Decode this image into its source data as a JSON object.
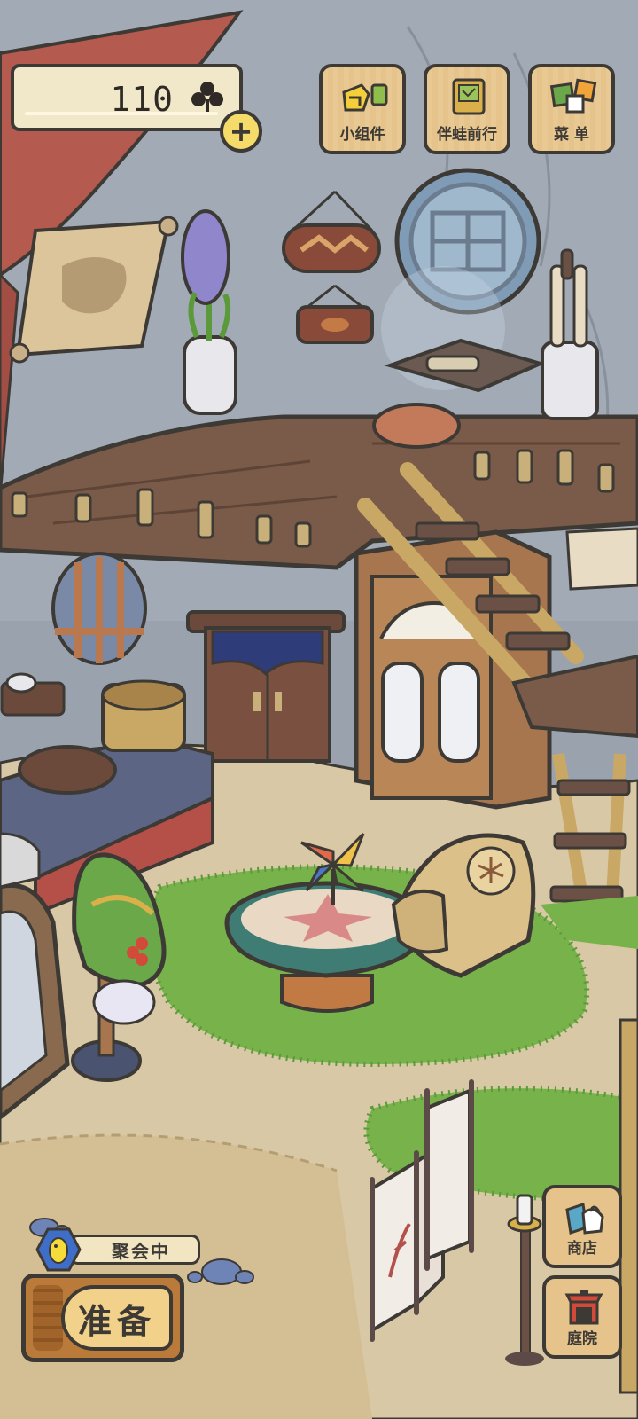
{
  "hud": {
    "clover_count": "110",
    "clover_icon": "clover-icon",
    "add_icon": "plus-icon"
  },
  "top_menu": [
    {
      "label": "小组件",
      "icon": "widget-icon"
    },
    {
      "label": "伴蛙前行",
      "icon": "album-icon"
    },
    {
      "label": "菜 单",
      "icon": "menu-cards-icon"
    }
  ],
  "party": {
    "status_label": "聚会中",
    "icon": "bird-hex-icon"
  },
  "prepare_button": {
    "label": "准备"
  },
  "side_menu": [
    {
      "label": "商店",
      "icon": "shop-bags-icon"
    },
    {
      "label": "庭院",
      "icon": "garden-gate-icon"
    }
  ],
  "colors": {
    "wall": "#9aa3ad",
    "floor": "#d9c8a5",
    "wood": "#7a5a48",
    "button_bg": "#e6c38a",
    "outline": "#3d3a36",
    "grass": "#78b24a"
  }
}
